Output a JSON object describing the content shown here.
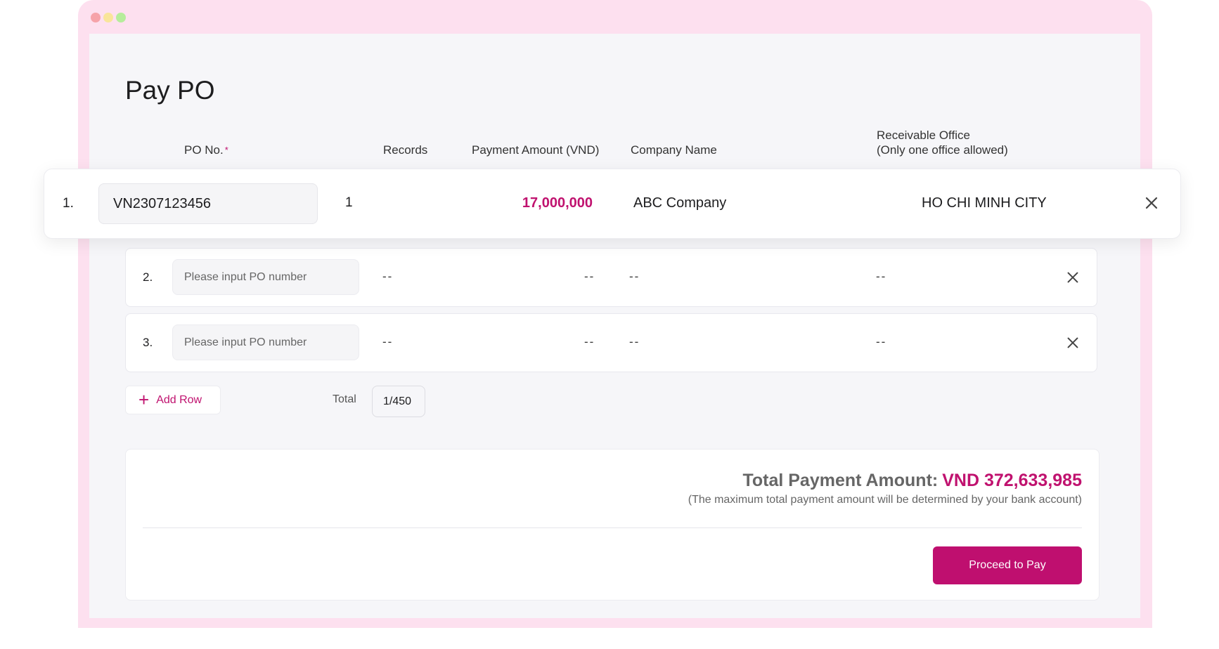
{
  "page": {
    "title": "Pay PO"
  },
  "columns": {
    "po_no": "PO No.",
    "required_mark": "*",
    "records": "Records",
    "payment_amount": "Payment Amount (VND)",
    "company_name": "Company Name",
    "receivable_office_line1": "Receivable Office",
    "receivable_office_line2": "(Only one office allowed)"
  },
  "rows": [
    {
      "index": "1.",
      "po_value": "VN2307123456",
      "records": "1",
      "amount": "17,000,000",
      "company": "ABC Company",
      "office": "HO CHI MINH CITY"
    },
    {
      "index": "2.",
      "po_placeholder": "Please input PO number",
      "records": "--",
      "amount": "--",
      "company": "--",
      "office": "--"
    },
    {
      "index": "3.",
      "po_placeholder": "Please input PO number",
      "records": "--",
      "amount": "--",
      "company": "--",
      "office": "--"
    }
  ],
  "actions": {
    "add_row_icon": "+",
    "add_row": "Add Row",
    "proceed": "Proceed to Pay"
  },
  "total": {
    "label": "Total",
    "value": "1/450"
  },
  "summary": {
    "label": "Total Payment Amount:",
    "value": "VND 372,633,985",
    "note": "(The maximum total payment amount will be determined by your bank account)"
  },
  "icons": {
    "remove": "close-icon",
    "add": "plus-icon"
  },
  "colors": {
    "accent": "#c0126f",
    "frame": "#fde0ef",
    "background": "#f6f6f9"
  }
}
